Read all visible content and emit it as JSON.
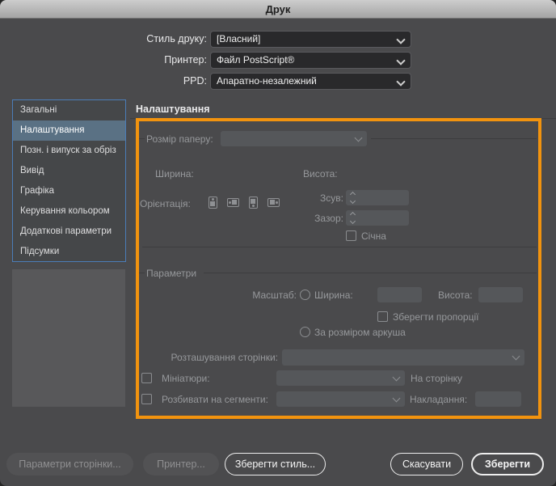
{
  "window": {
    "title": "Друк"
  },
  "top_form": {
    "rows": [
      {
        "label": "Стиль друку:",
        "value": "[Власний]"
      },
      {
        "label": "Принтер:",
        "value": "Файл PostScript®"
      },
      {
        "label": "PPD:",
        "value": "Апаратно-незалежний"
      }
    ]
  },
  "sidebar": {
    "items": [
      {
        "label": "Загальні"
      },
      {
        "label": "Налаштування"
      },
      {
        "label": "Позн. і випуск за обріз"
      },
      {
        "label": "Вивід"
      },
      {
        "label": "Графіка"
      },
      {
        "label": "Керування кольором"
      },
      {
        "label": "Додаткові параметри"
      },
      {
        "label": "Підсумки"
      }
    ],
    "selected": "Налаштування"
  },
  "main": {
    "section_title": "Налаштування",
    "setup_group": {
      "legend": "Розмір паперу:",
      "paper_size_value": "",
      "width_label": "Ширина:",
      "height_label": "Висота:",
      "orientation_label": "Орієнтація:",
      "orientation_icons": [
        "portrait-up",
        "landscape-left",
        "portrait-down",
        "landscape-right"
      ],
      "offset_label": "Зсув:",
      "offset_value": "",
      "gap_label": "Зазор:",
      "gap_value": "",
      "crop_checkbox_label": "Січна"
    },
    "options_group": {
      "legend": "Параметри",
      "scale_label": "Масштаб:",
      "scale_width_label": "Ширина:",
      "scale_width_value": "",
      "scale_height_label": "Висота:",
      "scale_height_value": "",
      "constrain_checkbox_label": "Зберегти пропорції",
      "fit_radio_label": "За розміром аркуша",
      "placement_label": "Розташування сторінки:",
      "placement_value": "",
      "thumbnails_checkbox_label": "Мініатюри:",
      "thumbnails_value": "",
      "per_page_label": "На сторінку",
      "tile_checkbox_label": "Розбивати на сегменти:",
      "tile_value": "",
      "overlap_label": "Накладання:",
      "overlap_value": ""
    }
  },
  "footer": {
    "page_setup_label": "Параметри сторінки...",
    "printer_label": "Принтер...",
    "save_preset_label": "Зберегти стиль...",
    "cancel_label": "Скасувати",
    "save_label": "Зберегти"
  },
  "colors": {
    "highlight_border": "#f2930e",
    "sidebar_selection": "#5a7184",
    "sidebar_border": "#4b7db8",
    "window_background": "#4a4a4c"
  }
}
